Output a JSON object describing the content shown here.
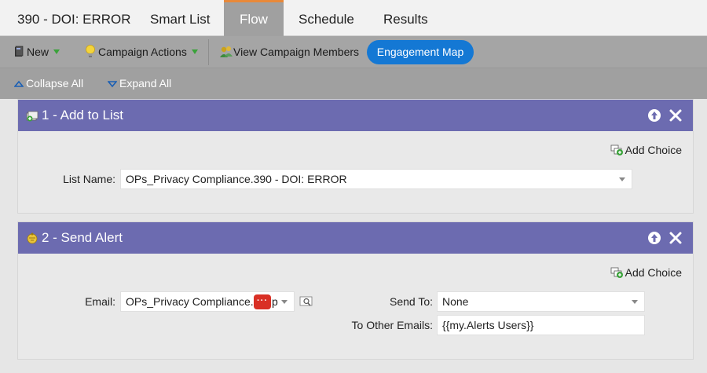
{
  "tabs": {
    "title": "390 - DOI: ERROR",
    "smart_list": "Smart List",
    "flow": "Flow",
    "schedule": "Schedule",
    "results": "Results"
  },
  "toolbar": {
    "new_label": "New",
    "campaign_actions_label": "Campaign Actions",
    "view_members_label": "View Campaign Members",
    "engagement_map_label": "Engagement Map",
    "collapse_all_label": "Collapse All",
    "expand_all_label": "Expand All"
  },
  "steps": [
    {
      "title": "1 - Add to List",
      "add_choice_label": "Add Choice",
      "list_name_label": "List Name:",
      "list_name_value": "OPs_Privacy Compliance.390 - DOI: ERROR"
    },
    {
      "title": "2 - Send Alert",
      "add_choice_label": "Add Choice",
      "email_label": "Email:",
      "email_value": "OPs_Privacy Compliance.",
      "email_value_tail": "p",
      "send_to_label": "Send To:",
      "send_to_value": "None",
      "other_emails_label": "To Other Emails:",
      "other_emails_value": "{{my.Alerts Users}}"
    }
  ],
  "colors": {
    "step_header": "#6c6bb0",
    "active_tab_border": "#e8893a",
    "engagement_button": "#1478d4",
    "error_badge": "#d93025"
  }
}
